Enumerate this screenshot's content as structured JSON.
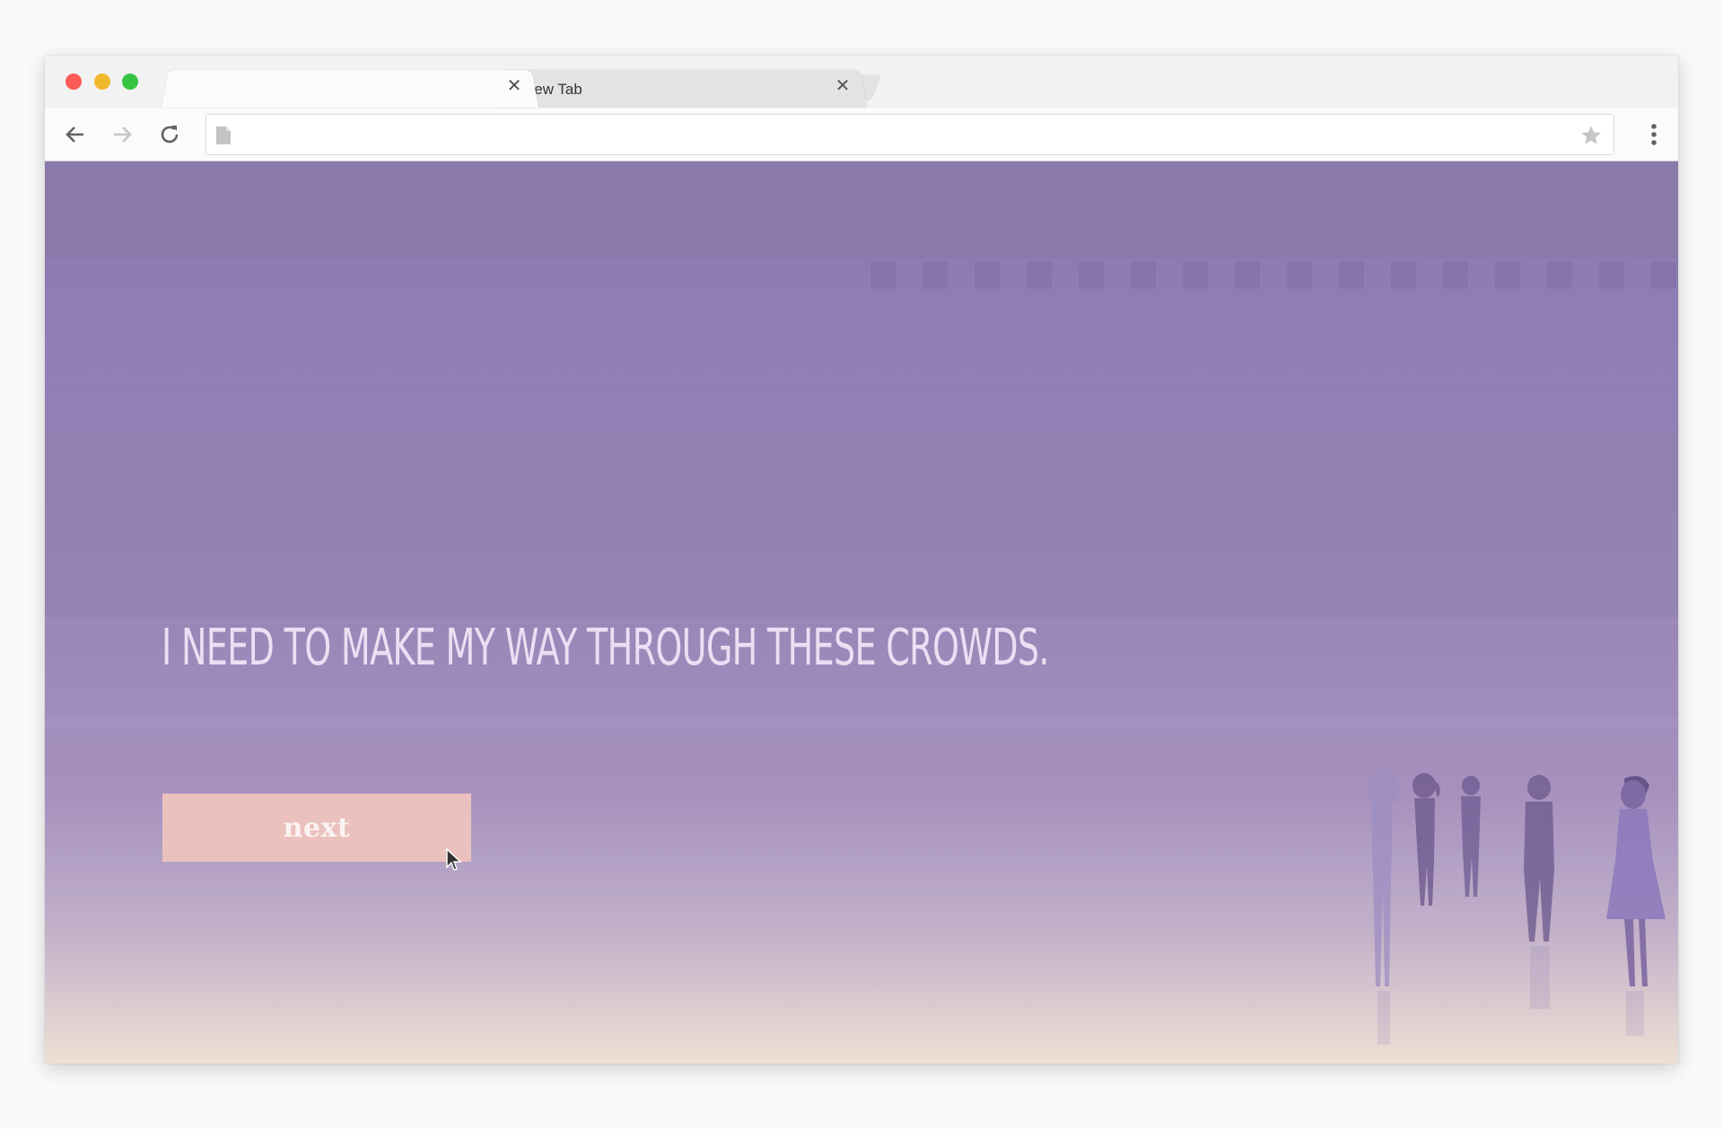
{
  "browser": {
    "tabs": [
      {
        "label": "",
        "active": true
      },
      {
        "label": "New Tab",
        "active": false
      }
    ],
    "address_bar": {
      "value": ""
    }
  },
  "page": {
    "narration": "I need to make my way through these crowds.",
    "next_label": "next"
  },
  "colors": {
    "sky_top": "#8a7aab",
    "sky_bottom": "#efe0d4",
    "button": "#eac1bd",
    "text": "#eadff3"
  },
  "icons": [
    "back-arrow-icon",
    "forward-arrow-icon",
    "reload-icon",
    "page-icon",
    "star-icon",
    "menu-dots-icon",
    "close-icon",
    "cursor-icon"
  ]
}
